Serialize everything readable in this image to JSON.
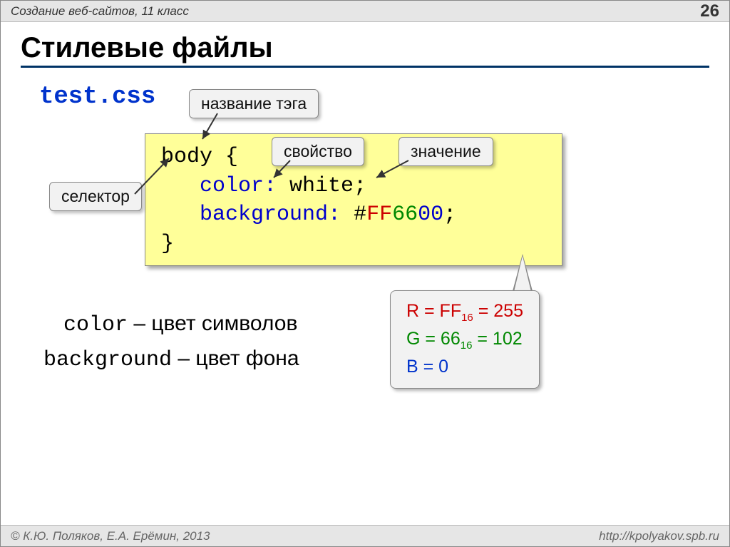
{
  "topbar": {
    "subject": "Создание веб-сайтов, 11 класс",
    "page": "26"
  },
  "title": "Стилевые файлы",
  "filename": "test.css",
  "callouts": {
    "tagname": "название тэга",
    "property": "свойство",
    "value": "значение",
    "selector": "селектор"
  },
  "code": {
    "line1": "body {",
    "line2_indent": "   ",
    "line2_prop": "color:",
    "line2_val": " white",
    "line2_end": ";",
    "line3_indent": "   ",
    "line3_prop": "background:",
    "line3_sp": " ",
    "line3_hash": "#",
    "line3_ff": "FF",
    "line3_66": "66",
    "line3_00": "00",
    "line3_end": ";",
    "line4": "}"
  },
  "defs": {
    "color_kw": "color",
    "color_text": " – цвет символов",
    "bg_kw": "background",
    "bg_text": " – цвет фона"
  },
  "rgb": {
    "r": "R = FF",
    "r_sub": "16",
    "r_eq": " = 255",
    "g": "G = 66",
    "g_sub": "16",
    "g_eq": " = 102",
    "b": "B = 0"
  },
  "footer": {
    "left": "© К.Ю. Поляков, Е.А. Ерёмин, 2013",
    "right": "http://kpolyakov.spb.ru"
  }
}
